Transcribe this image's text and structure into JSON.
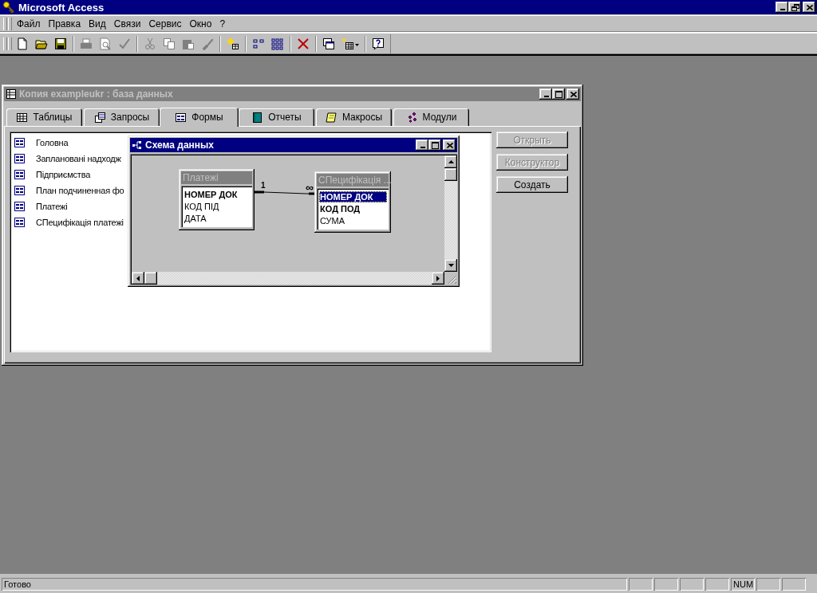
{
  "app": {
    "title": "Microsoft Access",
    "active": true
  },
  "menu": [
    {
      "label": "Файл"
    },
    {
      "label": "Правка"
    },
    {
      "label": "Вид"
    },
    {
      "label": "Связи"
    },
    {
      "label": "Сервис"
    },
    {
      "label": "Окно"
    },
    {
      "label": "?"
    }
  ],
  "toolbar": [
    {
      "disabled": false
    },
    {
      "disabled": false
    },
    {
      "disabled": false
    },
    {
      "disabled": true
    },
    {
      "disabled": true
    },
    {
      "disabled": true
    },
    {
      "disabled": true
    },
    {
      "disabled": true
    },
    {
      "disabled": true
    },
    {
      "disabled": true
    },
    {
      "disabled": false
    },
    {
      "disabled": false
    },
    {
      "disabled": false
    },
    {
      "disabled": false
    },
    {
      "disabled": false
    },
    {
      "disabled": false
    },
    {
      "disabled": false
    }
  ],
  "database_window": {
    "title": "Копия exampleukr : база данных",
    "active": false,
    "tabs": [
      {
        "label": "Таблицы",
        "selected": false
      },
      {
        "label": "Запросы",
        "selected": false
      },
      {
        "label": "Формы",
        "selected": true
      },
      {
        "label": "Отчеты",
        "selected": false
      },
      {
        "label": "Макросы",
        "selected": false
      },
      {
        "label": "Модули",
        "selected": false
      }
    ],
    "items": [
      {
        "label": "Головна"
      },
      {
        "label": "Заплановані надходж"
      },
      {
        "label": "Підприємства"
      },
      {
        "label": "План подчиненная фо"
      },
      {
        "label": "Платежі"
      },
      {
        "label": "СПецифікація платежі"
      }
    ],
    "buttons": [
      {
        "label": "Открыть",
        "disabled": true
      },
      {
        "label": "Конструктор",
        "disabled": true
      },
      {
        "label": "Создать",
        "disabled": false
      }
    ]
  },
  "relationships_window": {
    "title": "Схема данных",
    "active": true,
    "tables": [
      {
        "title": "Платежі",
        "fields": [
          {
            "name": "НОМЕР ДОК",
            "key": true,
            "selected": false
          },
          {
            "name": "КОД ПІД",
            "key": false,
            "selected": false
          },
          {
            "name": "ДАТА",
            "key": false,
            "selected": false
          }
        ]
      },
      {
        "title": "СПецифікація ...",
        "fields": [
          {
            "name": "НОМЕР ДОК",
            "key": true,
            "selected": true
          },
          {
            "name": "КОД ПОД",
            "key": true,
            "selected": false
          },
          {
            "name": "СУМА",
            "key": false,
            "selected": false
          }
        ]
      }
    ],
    "relationship": {
      "one_label": "1",
      "many_label": "∞"
    }
  },
  "status_bar": {
    "text": "Готово",
    "indicator": "NUM"
  }
}
